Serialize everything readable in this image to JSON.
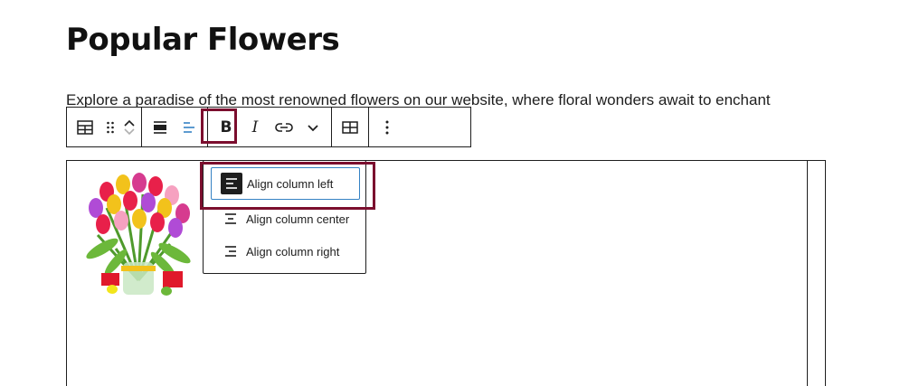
{
  "page": {
    "title": "Popular Flowers",
    "paragraph": "Explore a paradise of the most renowned flowers on our website, where floral wonders await to enchant"
  },
  "toolbar": {
    "icons": [
      "table-icon",
      "drag-handle-icon",
      "move-up-icon",
      "move-down-icon",
      "align-icon",
      "align-column-icon",
      "bold-icon",
      "italic-icon",
      "link-icon",
      "chevron-down-icon",
      "edit-table-icon",
      "more-options-icon"
    ],
    "bold_label": "B",
    "italic_label": "I"
  },
  "dropdown": {
    "items": [
      {
        "label": "Align column left",
        "icon": "align-left-icon",
        "selected": true
      },
      {
        "label": "Align column center",
        "icon": "align-center-icon",
        "selected": false
      },
      {
        "label": "Align column right",
        "icon": "align-right-icon",
        "selected": false
      }
    ]
  },
  "colors": {
    "highlight": "#7b0e2e",
    "focus": "#3582c4",
    "text": "#1e1e1e"
  }
}
